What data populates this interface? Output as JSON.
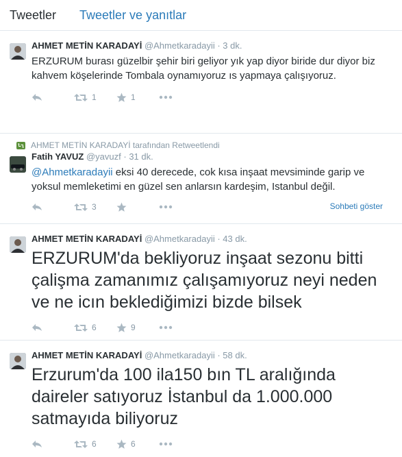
{
  "tabs": {
    "tweets": "Tweetler",
    "tweets_replies": "Tweetler ve yanıtlar"
  },
  "tweets": [
    {
      "fullname": "AHMET METİN KARADAYİ",
      "username": "@Ahmetkaradayii",
      "time": "· 3 dk.",
      "text": "ERZURUM burası güzelbir şehir biri geliyor yık yap diyor biride dur diyor biz kahvem köşelerinde Tombala oynamıyoruz ıs yapmaya çalışıyoruz.",
      "retweets": "1",
      "favorites": "1"
    },
    {
      "retweet_context": "AHMET METİN KARADAYİ tarafından Retweetlendi",
      "fullname": "Fatih YAVUZ",
      "username": "@yavuzf",
      "time": "· 31 dk.",
      "mention": "@Ahmetkaradayii",
      "text": " eksi 40 derecede, cok kısa inşaat mevsiminde garip ve yoksul memleketimi en güzel sen anlarsın kardeşim,  Istanbul değil.",
      "retweets": "3",
      "favorites": "",
      "conversation_link": "Sohbeti göster"
    },
    {
      "fullname": "AHMET METİN KARADAYİ",
      "username": "@Ahmetkaradayii",
      "time": "· 43 dk.",
      "text": "ERZURUM'da bekliyoruz inşaat sezonu bitti çalişma zamanımız  çalışamıyoruz neyi neden ve ne icın  beklediğimizi bizde bilsek",
      "retweets": "6",
      "favorites": "9"
    },
    {
      "fullname": "AHMET METİN KARADAYİ",
      "username": "@Ahmetkaradayii",
      "time": "· 58 dk.",
      "text": "Erzurum'da 100 ila150 bın TL aralığında daireler satıyoruz İstanbul da 1.000.000 satmayıda biliyoruz",
      "retweets": "6",
      "favorites": "6"
    }
  ],
  "colors": {
    "link": "#2b7bb9",
    "muted": "#8899a6",
    "icon": "#aab8c2",
    "retweet_green": "#5c913b"
  }
}
